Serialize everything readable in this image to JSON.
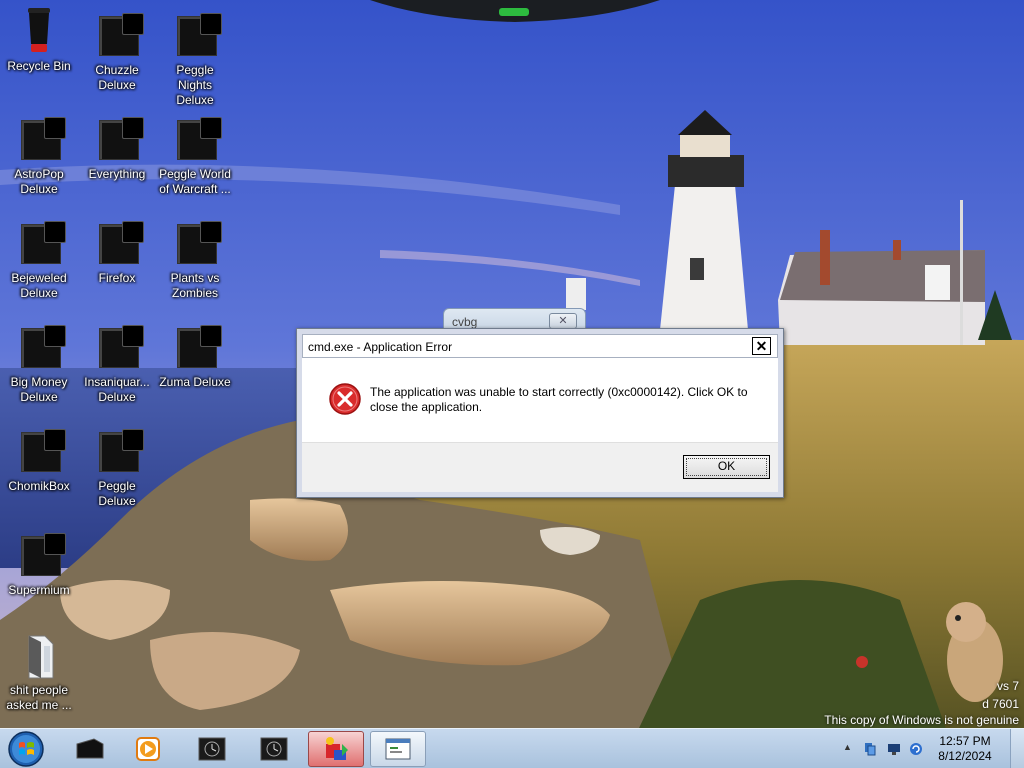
{
  "desktop": {
    "icons": [
      {
        "label": "Recycle Bin"
      },
      {
        "label": "Chuzzle\nDeluxe"
      },
      {
        "label": "Peggle Nights\nDeluxe"
      },
      {
        "label": "AstroPop\nDeluxe"
      },
      {
        "label": "Everything"
      },
      {
        "label": "Peggle World\nof Warcraft ..."
      },
      {
        "label": "Bejeweled\nDeluxe"
      },
      {
        "label": "Firefox"
      },
      {
        "label": "Plants vs\nZombies"
      },
      {
        "label": "Big Money\nDeluxe"
      },
      {
        "label": "Insaniquar...\nDeluxe"
      },
      {
        "label": "Zuma Deluxe"
      },
      {
        "label": "ChomikBox"
      },
      {
        "label": "Peggle Deluxe"
      },
      {
        "label": "Supermium"
      },
      {
        "label": "shit people\nasked me ..."
      }
    ]
  },
  "background_window": {
    "title": "cvbg",
    "close_glyph": "✕"
  },
  "dialog": {
    "title": "cmd.exe - Application Error",
    "close_glyph": "✕",
    "message": "The application was unable to start correctly (0xc0000142). Click OK to close the application.",
    "ok_label": "OK",
    "icon": "error-icon"
  },
  "watermark": {
    "line1": "vs 7",
    "line2": "d 7601",
    "line3": "This copy of Windows is not genuine"
  },
  "taskbar": {
    "start_icon": "windows-orb-icon",
    "items": [
      {
        "icon": "app-dark-icon",
        "state": "idle"
      },
      {
        "icon": "media-player-icon",
        "state": "idle"
      },
      {
        "icon": "clock-app-icon",
        "state": "idle"
      },
      {
        "icon": "clock-app-icon",
        "state": "idle"
      },
      {
        "icon": "colorful-app-icon",
        "state": "active"
      },
      {
        "icon": "window-app-icon",
        "state": "open"
      }
    ],
    "tray": {
      "show_hidden": "▲",
      "time": "12:57 PM",
      "date": "8/12/2024"
    }
  },
  "colors": {
    "taskbar": "#b7cde6",
    "dialog_frame": "#d6dbe9",
    "error_red": "#d92b2b",
    "active_task": "#e07070"
  }
}
